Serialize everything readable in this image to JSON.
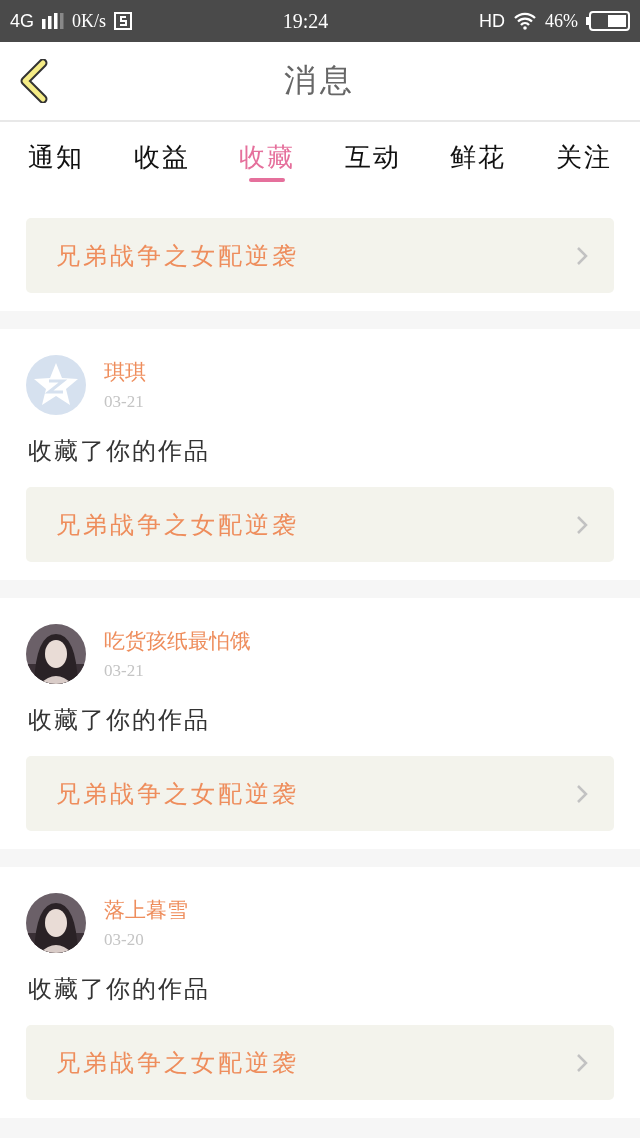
{
  "status_bar": {
    "network": "4G",
    "speed": "0K/s",
    "time": "19:24",
    "hd": "HD",
    "battery": "46%"
  },
  "header": {
    "title": "消息"
  },
  "tabs": [
    {
      "label": "通知",
      "selected": false
    },
    {
      "label": "收益",
      "selected": false
    },
    {
      "label": "收藏",
      "selected": true
    },
    {
      "label": "互动",
      "selected": false
    },
    {
      "label": "鲜花",
      "selected": false
    },
    {
      "label": "关注",
      "selected": false
    }
  ],
  "messages": [
    {
      "kind": "partial",
      "work": "兄弟战争之女配逆袭"
    },
    {
      "kind": "full",
      "avatar": {
        "kind": "icon"
      },
      "user": "琪琪",
      "date": "03-21",
      "action": "收藏了你的作品",
      "work": "兄弟战争之女配逆袭"
    },
    {
      "kind": "full",
      "user": "吃货孩纸最怕饿",
      "date": "03-21",
      "action": "收藏了你的作品",
      "work": "兄弟战争之女配逆袭"
    },
    {
      "kind": "full",
      "user": "落上暮雪",
      "date": "03-20",
      "action": "收藏了你的作品",
      "work": "兄弟战争之女配逆袭"
    }
  ]
}
